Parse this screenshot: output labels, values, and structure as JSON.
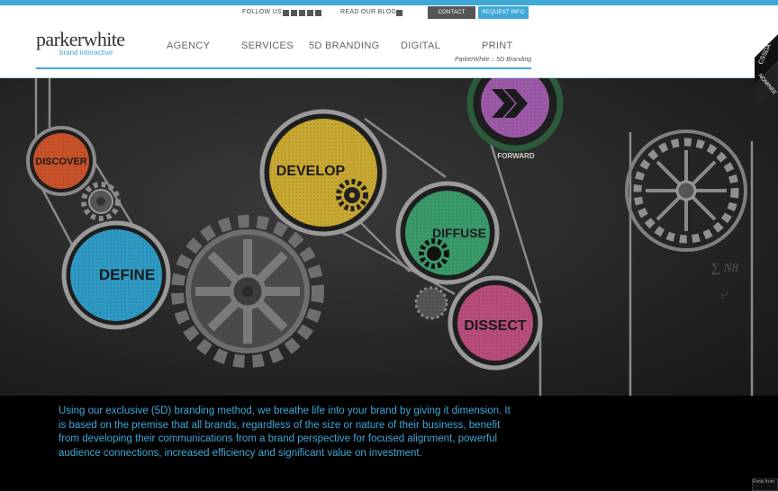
{
  "header": {
    "follow_label": "FOLLOW US",
    "blog_label": "READ OUR BLOG",
    "contact_button": "CONTACT",
    "request_button": "REQUEST INFO",
    "logo_name": "parkerwhite",
    "logo_tagline": "brand interactive",
    "breadcrumb": "ParkerWhite :: 5D Branding"
  },
  "nav": {
    "items": [
      {
        "label": "AGENCY"
      },
      {
        "label": "SERVICES"
      },
      {
        "label": "5D BRANDING"
      },
      {
        "label": "DIGITAL"
      },
      {
        "label": "PRINT"
      }
    ]
  },
  "hero": {
    "discover": "DISCOVER",
    "define": "DEFINE",
    "develop": "DEVELOP",
    "diffuse": "DIFFUSE",
    "dissect": "DISSECT",
    "forward": "FORWARD",
    "colors": {
      "discover": "#c9522a",
      "define": "#2f9ac4",
      "develop": "#c9a832",
      "diffuse": "#3a9a6a",
      "dissect": "#b84d7d",
      "forward": "#9d5aa8"
    }
  },
  "ribbon": {
    "cssda": "CSSDA",
    "nominee": "NOMINEE"
  },
  "body": {
    "paragraph": "Using our exclusive (5D) branding method, we breathe life into your brand by giving it dimension. It is based on the premise that all brands, regardless of the size or nature of their business, benefit from developing their communications from a brand perspective for focused alignment, powerful audience connections, increased efficiency and significant value on investment."
  },
  "footer": {
    "fonts_badge": "Fonts from"
  }
}
